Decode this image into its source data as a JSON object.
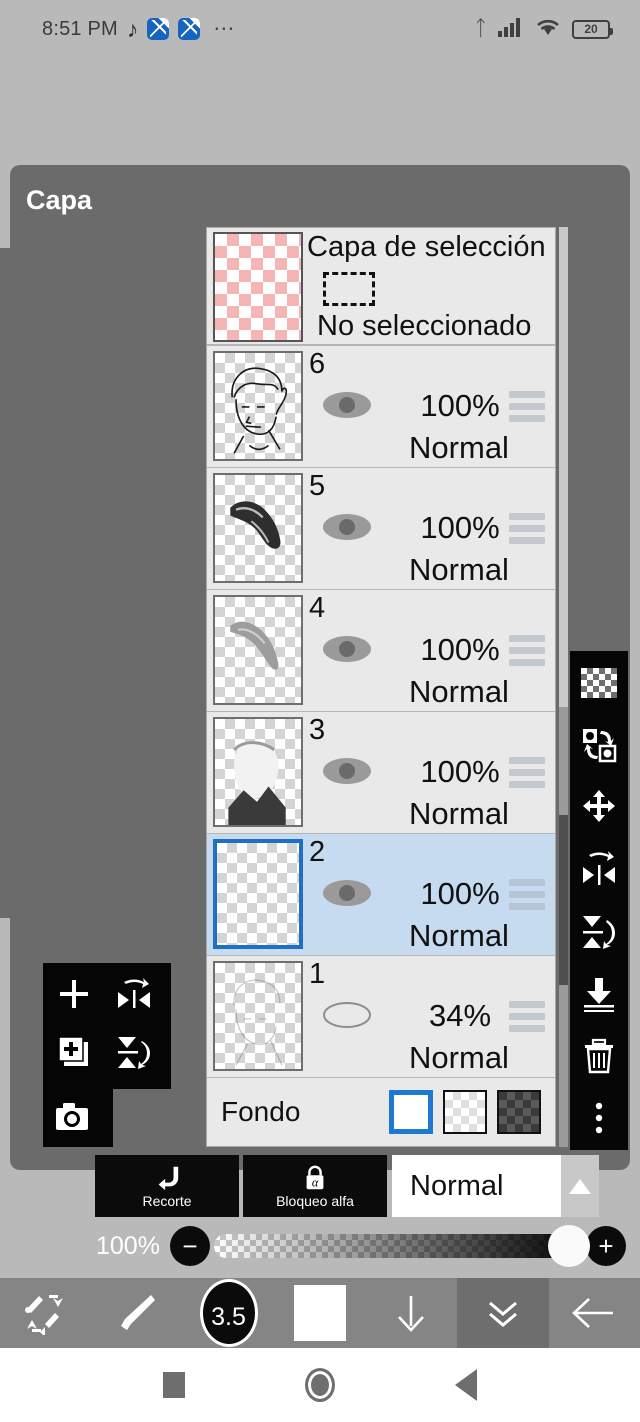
{
  "status_bar": {
    "time": "8:51 PM",
    "icons": [
      "tiktok-icon",
      "app-icon-1",
      "app-icon-2",
      "more-dots-icon"
    ],
    "right_icons": [
      "bluetooth-icon",
      "signal-icon",
      "wifi-icon"
    ],
    "battery_level": "20"
  },
  "layer_panel": {
    "title": "Capa",
    "selection_layer": {
      "title": "Capa de selección",
      "status": "No seleccionado"
    },
    "layers": [
      {
        "name": "6",
        "opacity": "100%",
        "blend": "Normal",
        "visible": true,
        "selected": false
      },
      {
        "name": "5",
        "opacity": "100%",
        "blend": "Normal",
        "visible": true,
        "selected": false
      },
      {
        "name": "4",
        "opacity": "100%",
        "blend": "Normal",
        "visible": true,
        "selected": false
      },
      {
        "name": "3",
        "opacity": "100%",
        "blend": "Normal",
        "visible": true,
        "selected": false
      },
      {
        "name": "2",
        "opacity": "100%",
        "blend": "Normal",
        "visible": true,
        "selected": true
      },
      {
        "name": "1",
        "opacity": "34%",
        "blend": "Normal",
        "visible": false,
        "selected": false
      }
    ],
    "background_row": {
      "label": "Fondo",
      "swatches": [
        "white",
        "transparent",
        "dark-checker"
      ],
      "selected_swatch": "white"
    }
  },
  "right_toolbar": {
    "items": [
      {
        "name": "transparency-icon"
      },
      {
        "name": "layer-transform-icon"
      },
      {
        "name": "move-icon"
      },
      {
        "name": "flip-horizontal-icon"
      },
      {
        "name": "flip-vertical-icon"
      },
      {
        "name": "merge-down-icon"
      },
      {
        "name": "delete-icon"
      },
      {
        "name": "more-vertical-icon"
      }
    ]
  },
  "left_toolbar": {
    "items": [
      {
        "name": "add-layer-icon"
      },
      {
        "name": "flip-horizontal-icon"
      },
      {
        "name": "duplicate-layer-icon"
      },
      {
        "name": "flip-vertical-icon"
      },
      {
        "name": "camera-icon"
      }
    ]
  },
  "actions": {
    "clip_label": "Recorte",
    "alpha_lock_label": "Bloqueo alfa",
    "blend_mode": "Normal"
  },
  "opacity_control": {
    "value": "100%",
    "minus_label": "−",
    "plus_label": "+"
  },
  "bottom_bar": {
    "items": [
      {
        "name": "undo-redo-icon"
      },
      {
        "name": "brush-icon"
      },
      {
        "name": "brush-size",
        "label": "3.5"
      },
      {
        "name": "color-swatch"
      },
      {
        "name": "download-icon"
      },
      {
        "name": "collapse-icon"
      },
      {
        "name": "back-arrow-icon"
      }
    ]
  },
  "nav_bar": {
    "items": [
      "recents-button",
      "home-button",
      "back-button"
    ]
  },
  "colors": {
    "panel_bg": "#6b6b6b",
    "list_bg": "#e9e9e9",
    "selected_row": "#c6dbf0",
    "accent_blue": "#1f6fc4",
    "workspace_bg": "#b9b9b9",
    "toolbar_black": "#050505"
  }
}
